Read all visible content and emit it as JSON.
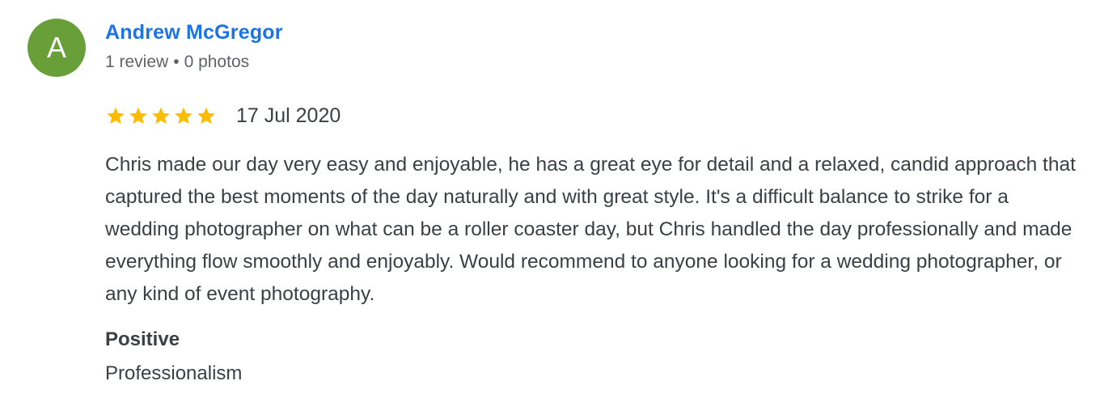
{
  "review": {
    "author": {
      "initial": "A",
      "name": "Andrew McGregor",
      "reviews_count": "1 review",
      "separator": "•",
      "photos_count": "0 photos",
      "avatar_color": "#689f38"
    },
    "rating": {
      "stars": 5,
      "max_stars": 5,
      "star_color": "#fbbc04",
      "star_icon": "star-icon"
    },
    "date": "17 Jul 2020",
    "text": "Chris made our day very easy and enjoyable, he has a great eye for detail and a relaxed, candid approach that captured the best moments of the day naturally and with great style. It's a difficult balance to strike for a wedding photographer on what can be a roller coaster day, but Chris handled the day professionally and made everything flow smoothly and enjoyably. Would recommend to anyone looking for a wedding photographer, or any kind of event photography.",
    "attribute": {
      "heading": "Positive",
      "value": "Professionalism"
    }
  },
  "colors": {
    "link": "#1a73e8",
    "secondary_text": "#5f6368",
    "primary_text": "#3c4043"
  }
}
